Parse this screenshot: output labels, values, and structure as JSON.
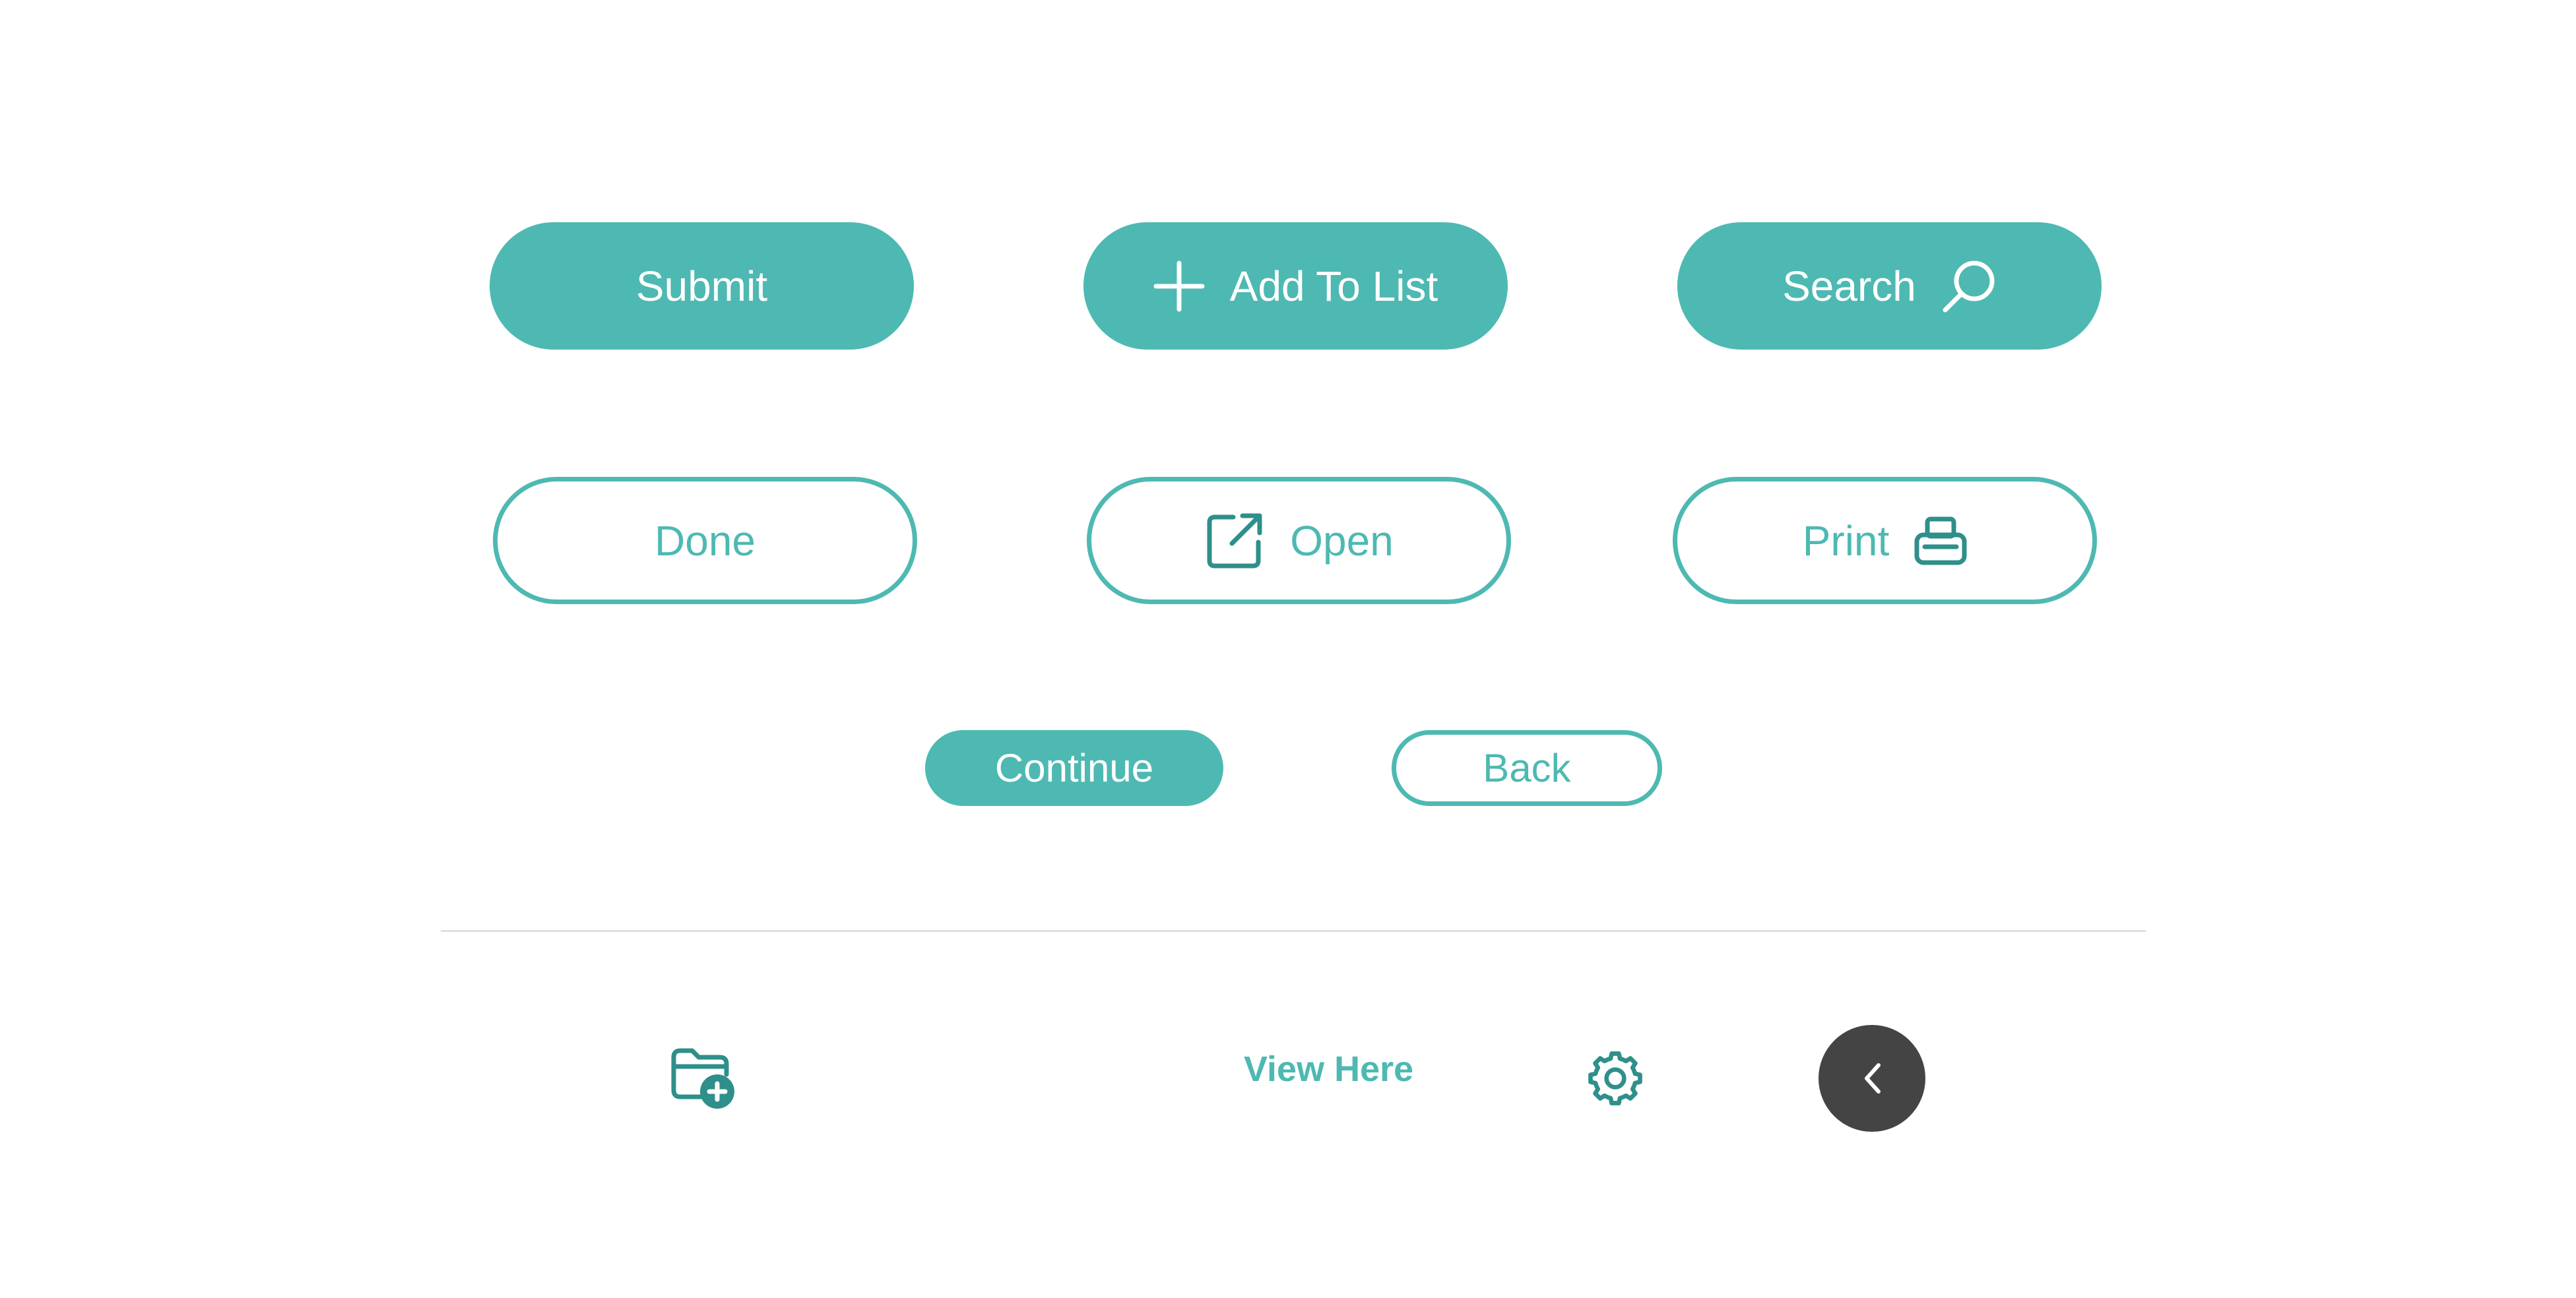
{
  "colors": {
    "accent": "#4db9b2",
    "dark": "#444444",
    "divider": "#e0e0e0"
  },
  "buttons": {
    "submit": "Submit",
    "add_to_list": "Add To List",
    "search": "Search",
    "done": "Done",
    "open": "Open",
    "print": "Print",
    "continue": "Continue",
    "back": "Back"
  },
  "icons": {
    "add_to_list": "plus-icon",
    "search": "search-icon",
    "open": "external-link-icon",
    "print": "printer-icon",
    "new_folder": "folder-plus-icon",
    "settings": "gear-icon",
    "back": "chevron-left-icon"
  },
  "footer": {
    "view_here": "View Here"
  }
}
